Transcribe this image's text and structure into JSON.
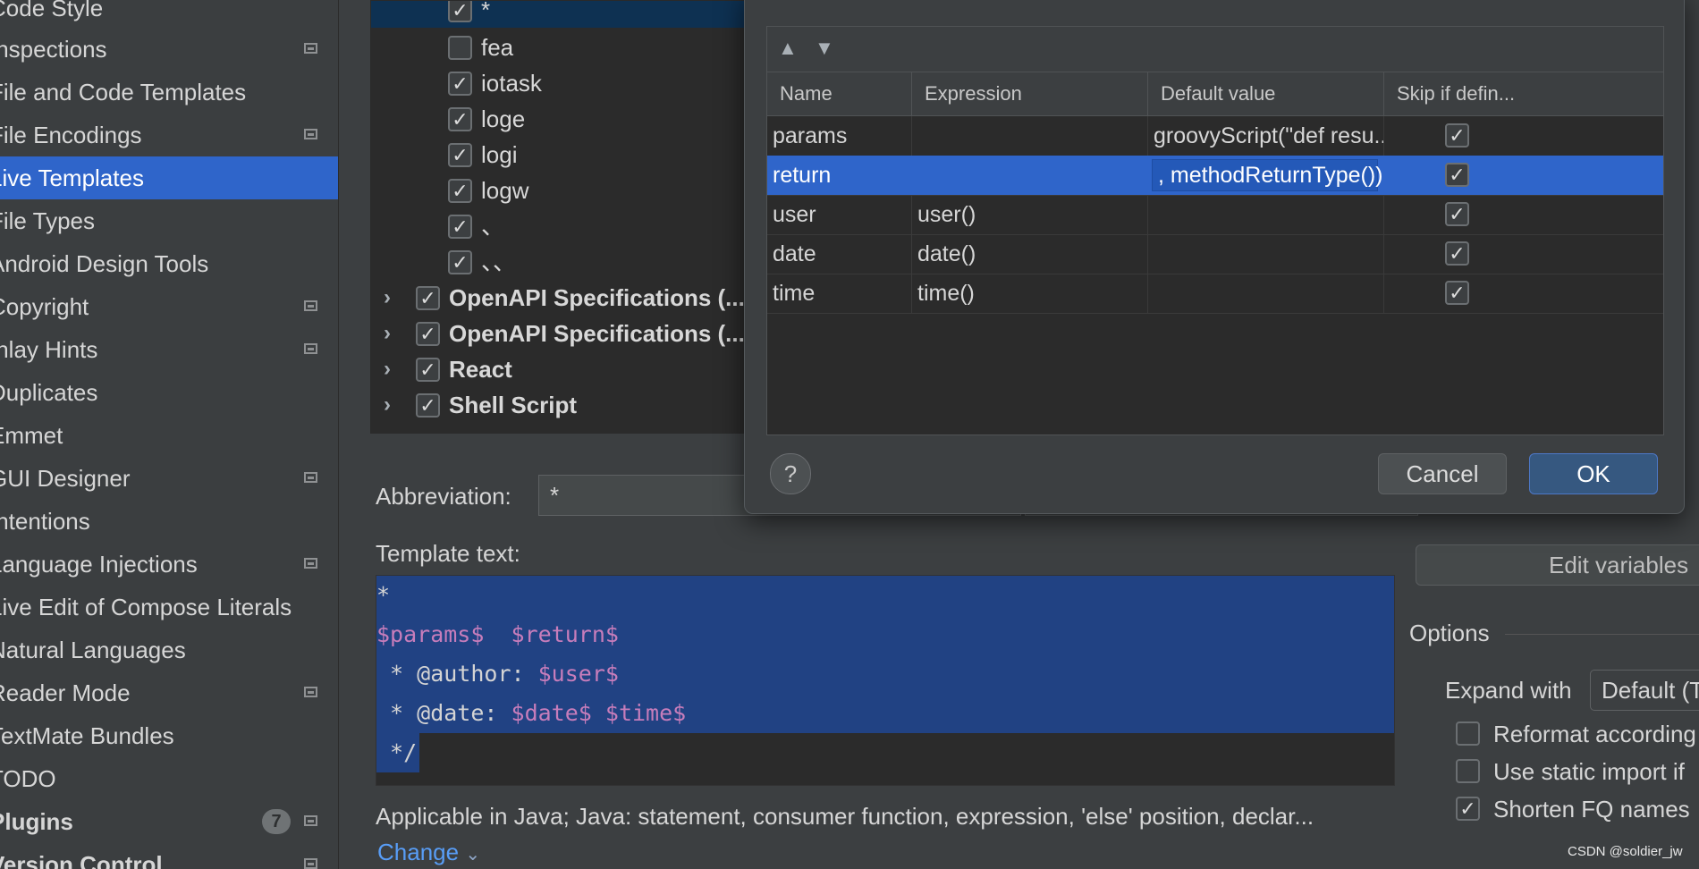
{
  "sidebar": {
    "items": [
      {
        "label": "Code Style",
        "module_icon": false,
        "selected": false,
        "bold": false
      },
      {
        "label": "Inspections",
        "module_icon": true,
        "selected": false,
        "bold": false
      },
      {
        "label": "File and Code Templates",
        "module_icon": false,
        "selected": false,
        "bold": false
      },
      {
        "label": "File Encodings",
        "module_icon": true,
        "selected": false,
        "bold": false
      },
      {
        "label": "Live Templates",
        "module_icon": false,
        "selected": true,
        "bold": false
      },
      {
        "label": "File Types",
        "module_icon": false,
        "selected": false,
        "bold": false
      },
      {
        "label": "Android Design Tools",
        "module_icon": false,
        "selected": false,
        "bold": false
      },
      {
        "label": "Copyright",
        "module_icon": true,
        "selected": false,
        "bold": false
      },
      {
        "label": "Inlay Hints",
        "module_icon": true,
        "selected": false,
        "bold": false
      },
      {
        "label": "Duplicates",
        "module_icon": false,
        "selected": false,
        "bold": false
      },
      {
        "label": "Emmet",
        "module_icon": false,
        "selected": false,
        "bold": false
      },
      {
        "label": "GUI Designer",
        "module_icon": true,
        "selected": false,
        "bold": false
      },
      {
        "label": "Intentions",
        "module_icon": false,
        "selected": false,
        "bold": false
      },
      {
        "label": "Language Injections",
        "module_icon": true,
        "selected": false,
        "bold": false
      },
      {
        "label": "Live Edit of Compose Literals",
        "module_icon": false,
        "selected": false,
        "bold": false
      },
      {
        "label": "Natural Languages",
        "module_icon": false,
        "selected": false,
        "bold": false
      },
      {
        "label": "Reader Mode",
        "module_icon": true,
        "selected": false,
        "bold": false
      },
      {
        "label": "TextMate Bundles",
        "module_icon": false,
        "selected": false,
        "bold": false
      },
      {
        "label": "TODO",
        "module_icon": false,
        "selected": false,
        "bold": false
      },
      {
        "label": "Plugins",
        "module_icon": true,
        "selected": false,
        "bold": true,
        "badge": "7"
      },
      {
        "label": "Version Control",
        "module_icon": true,
        "selected": false,
        "bold": true
      }
    ]
  },
  "tree": {
    "rows": [
      {
        "label": "*",
        "checked": true,
        "level": 1,
        "selected": true
      },
      {
        "label": "fea",
        "checked": false,
        "level": 1
      },
      {
        "label": "iotask",
        "checked": true,
        "level": 1
      },
      {
        "label": "loge",
        "checked": true,
        "level": 1
      },
      {
        "label": "logi",
        "checked": true,
        "level": 1
      },
      {
        "label": "logw",
        "checked": true,
        "level": 1
      },
      {
        "label": "、",
        "checked": true,
        "level": 1
      },
      {
        "label": "、、",
        "checked": true,
        "level": 1
      },
      {
        "label": "OpenAPI Specifications (...",
        "checked": true,
        "level": 0
      },
      {
        "label": "OpenAPI Specifications (...",
        "checked": true,
        "level": 0
      },
      {
        "label": "React",
        "checked": true,
        "level": 0
      },
      {
        "label": "Shell Script",
        "checked": true,
        "level": 0
      }
    ]
  },
  "editor_form": {
    "abbreviation_label": "Abbreviation:",
    "abbreviation_value": "*",
    "template_text_label": "Template text:",
    "template_lines": [
      [
        {
          "t": "*",
          "var": false
        }
      ],
      [
        {
          "t": "$params$",
          "var": true
        },
        {
          "t": "  ",
          "var": false
        },
        {
          "t": "$return$",
          "var": true
        }
      ],
      [
        {
          "t": " * @author: ",
          "var": false
        },
        {
          "t": "$user$",
          "var": true
        }
      ],
      [
        {
          "t": " * @date: ",
          "var": false
        },
        {
          "t": "$date$",
          "var": true
        },
        {
          "t": " ",
          "var": false
        },
        {
          "t": "$time$",
          "var": true
        }
      ],
      [
        {
          "t": " */",
          "var": false
        }
      ]
    ],
    "applicable_text": "Applicable in Java; Java: statement, consumer function, expression, 'else' position, declar...",
    "change_link": "Change",
    "change_chevron": "⌄"
  },
  "options": {
    "edit_variables_label": "Edit variables",
    "options_title": "Options",
    "expand_with_label": "Expand with",
    "expand_with_value": "Default (T",
    "checkboxes": [
      {
        "label": "Reformat according",
        "checked": false
      },
      {
        "label": "Use static import if",
        "checked": false
      },
      {
        "label": "Shorten FQ names",
        "checked": true
      }
    ]
  },
  "dialog": {
    "toolbar": {
      "move_up": "▲",
      "move_down": "▼"
    },
    "columns": [
      "Name",
      "Expression",
      "Default value",
      "Skip if defin..."
    ],
    "rows": [
      {
        "name": "params",
        "expression": "",
        "default_value": "groovyScript(\"def resu...",
        "skip": true,
        "selected": false,
        "editing": false
      },
      {
        "name": "return",
        "expression": "",
        "default_value": ", methodReturnType());",
        "skip": true,
        "selected": true,
        "editing": true
      },
      {
        "name": "user",
        "expression": "user()",
        "default_value": "",
        "skip": true,
        "selected": false,
        "editing": false
      },
      {
        "name": "date",
        "expression": "date()",
        "default_value": "",
        "skip": true,
        "selected": false,
        "editing": false
      },
      {
        "name": "time",
        "expression": "time()",
        "default_value": "",
        "skip": true,
        "selected": false,
        "editing": false
      }
    ],
    "help_label": "?",
    "cancel_label": "Cancel",
    "ok_label": "OK"
  },
  "watermark": "CSDN @soldier_jw",
  "colors": {
    "selection": "#2f65ca",
    "template_selection": "#214283",
    "template_variable": "#c77dbb",
    "link": "#589df6"
  }
}
